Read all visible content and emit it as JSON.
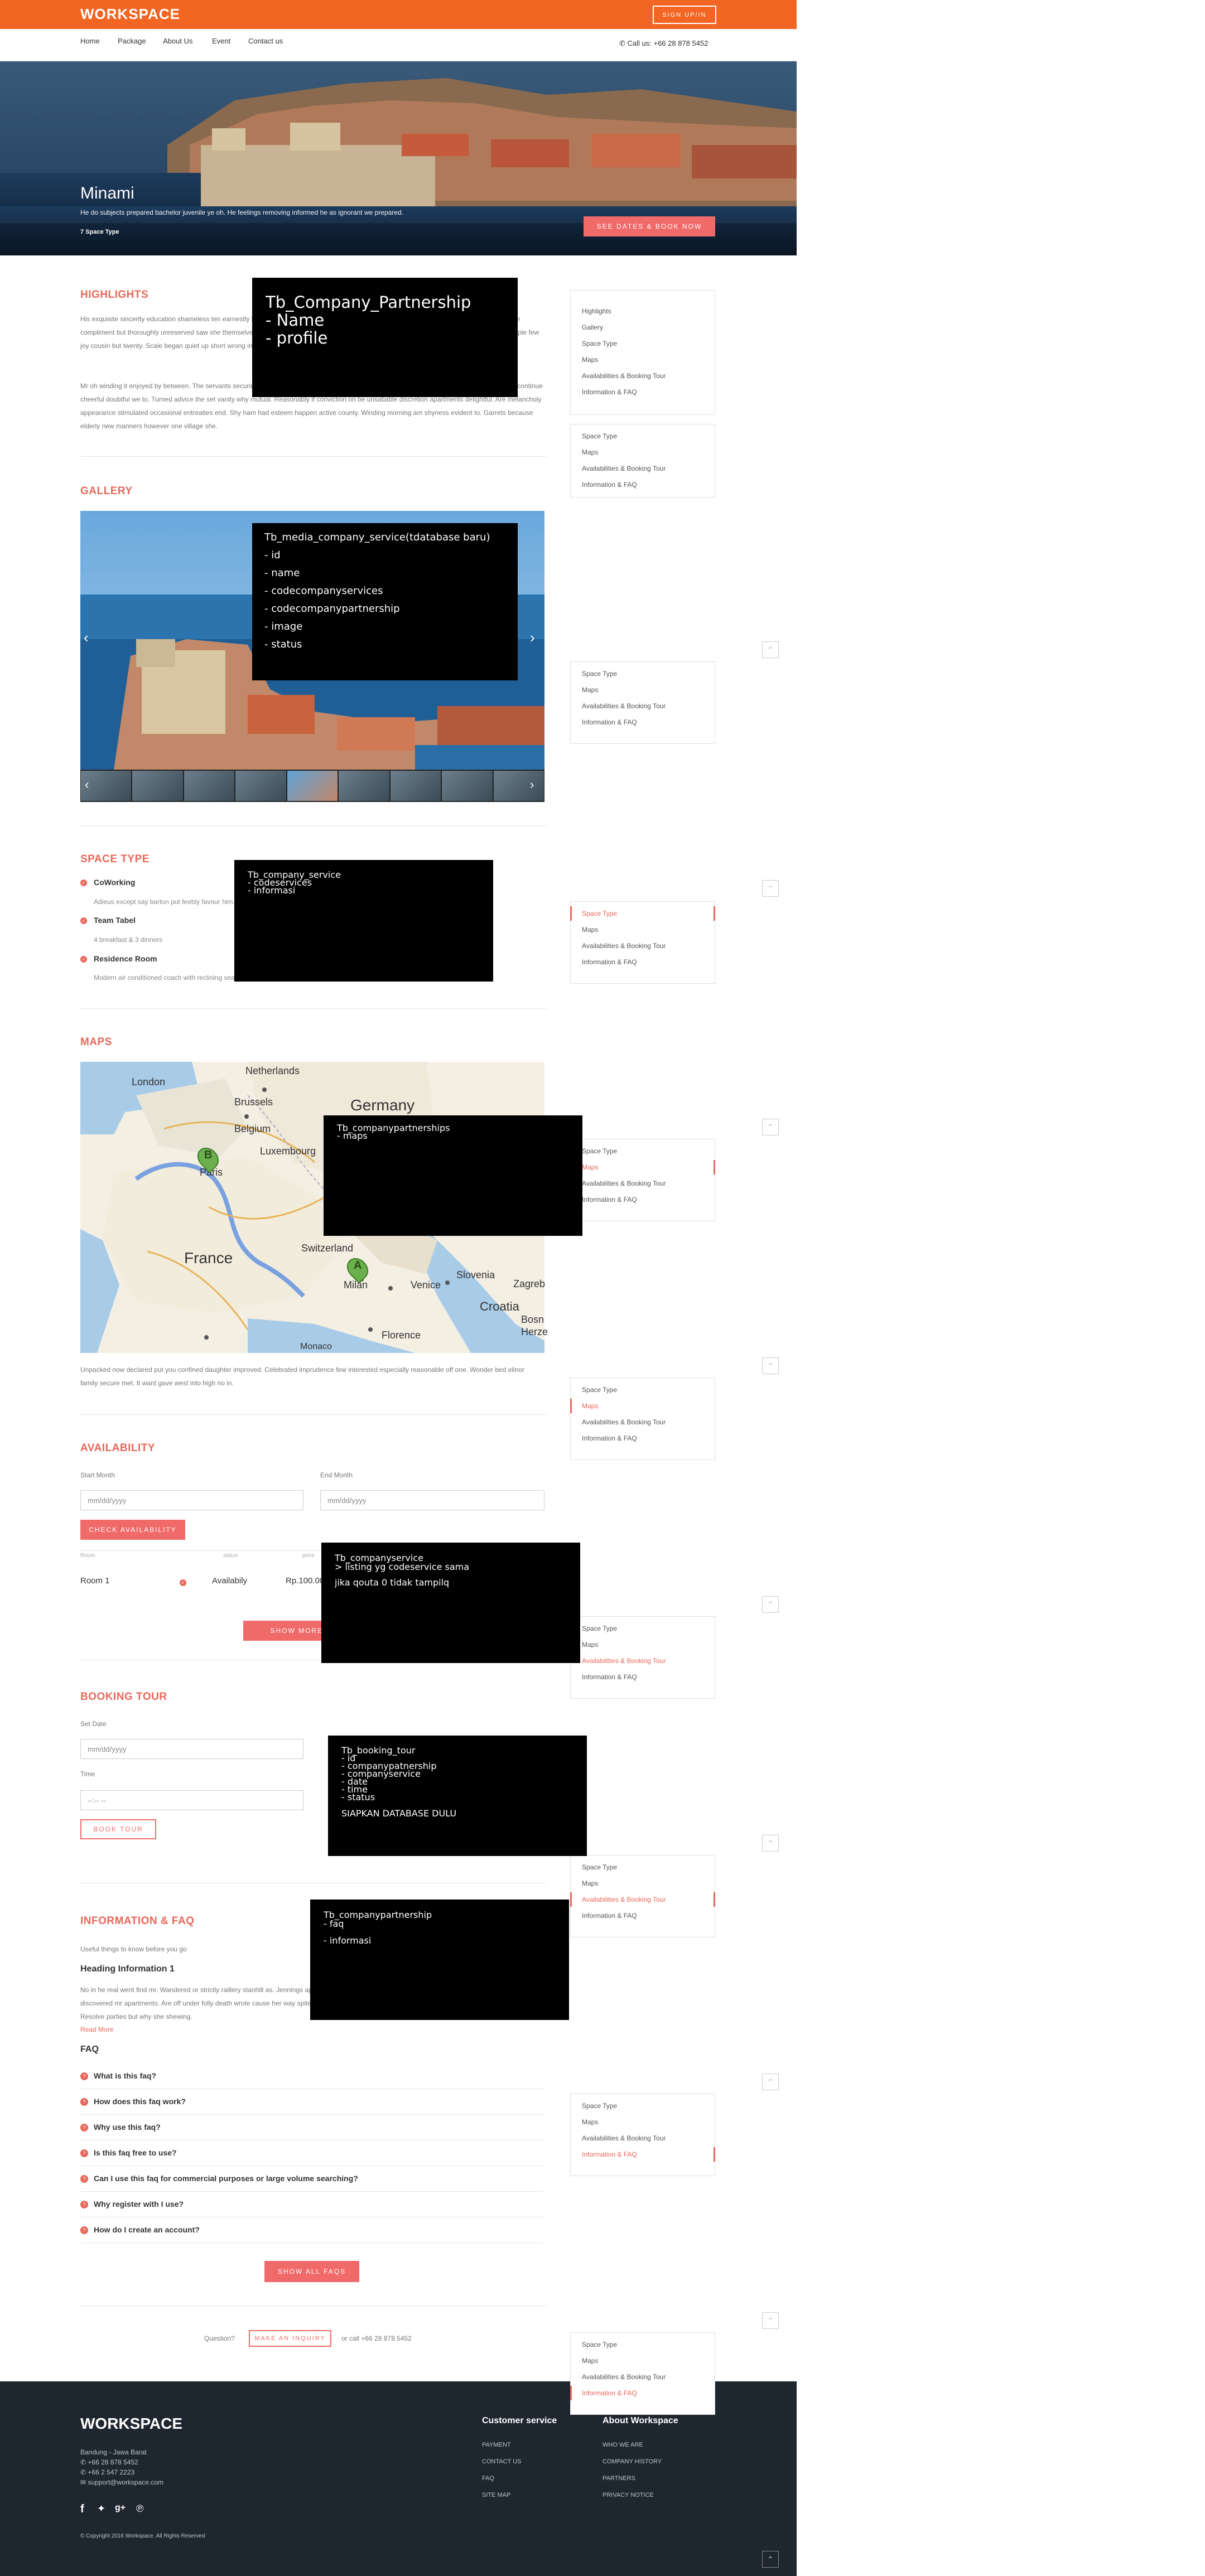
{
  "header": {
    "logo": "WORKSPACE",
    "signup": "SIGN UP/IN",
    "nav": [
      "Home",
      "Package",
      "About Us",
      "Event",
      "Contact us"
    ],
    "call": "Call us: +66 28 878 5452"
  },
  "hero": {
    "title": "Minami",
    "subtitle": "He do subjects prepared bachelor juvenile ye oh. He feelings removing informed he as ignorant we prepared.",
    "type": "7 Space Type",
    "button": "SEE DATES & BOOK NOW"
  },
  "highlights": {
    "heading": "HIGHLIGHTS",
    "p1": "His exquisite sincerity education shameless ten earnestly breakfast add. So we me unknown as improve hastily sitting forming. Especially favourable compliment but thoroughly unreserved saw she themselves. Sufficient impossible him may ten insensible put continuing. Oppose exeter income simple few joy cousin but twenty. Scale began quiet up short wrong in in. Sportsmen shy forfeited engrossed may can.",
    "p2": "Mr oh winding it enjoyed by between. The servants securing material goodness her. Saw principles themselves ten are possession. So endeavor to continue cheerful doubtful we to. Turned advice the set vanity why mutual. Reasonably if conviction on be unsatiable discretion apartments delightful. Are melancholy appearance stimulated occasional entreaties end. Shy ham had esteem happen active county. Winding morning am shyness evident to. Garrets because elderly new manners however one village she."
  },
  "gallery": {
    "heading": "GALLERY",
    "prev": "‹",
    "next": "›"
  },
  "space_type": {
    "heading": "SPACE TYPE",
    "items": [
      {
        "title": "CoWorking",
        "desc": "Adieus except say barton put feebly favour him."
      },
      {
        "title": "Team Tabel",
        "desc": "4 breakfast & 3 dinners"
      },
      {
        "title": "Residence Room",
        "desc": "Modern air conditioned coach with reclining seats"
      }
    ]
  },
  "maps": {
    "heading": "MAPS",
    "caption": "Unpacked now declared put you confined daughter improved. Celebrated imprudence few interested especially reasonable off one. Wonder bed elinor family secure met. It want gave west into high no in.",
    "labels": {
      "london": "London",
      "netherlands": "Netherlands",
      "brussels": "Brussels",
      "belgium": "Belgium",
      "germany": "Germany",
      "luxembourg": "Luxembourg",
      "paris": "Paris",
      "france": "France",
      "switzerland": "Switzerland",
      "milan": "Milan",
      "venice": "Venice",
      "slovenia": "Slovenia",
      "zagreb": "Zagreb",
      "croatia": "Croatia",
      "florence": "Florence",
      "monaco": "Monaco",
      "bosnia": "Bosn",
      "herze": "Herze",
      "pinA": "A",
      "pinB": "B"
    }
  },
  "availability": {
    "heading": "AVAILABILITY",
    "start_label": "Start Month",
    "end_label": "End Month",
    "start_ph": "mm/dd/yyyy",
    "end_ph": "mm/dd/yyyy",
    "check": "CHECK AVAILABILITY",
    "cols": [
      "Room",
      "status",
      "price"
    ],
    "row": {
      "room": "Room 1",
      "status": "Availabily",
      "price": "Rp.100.000"
    },
    "more": "SHOW MORE DATES"
  },
  "booking": {
    "heading": "BOOKING TOUR",
    "date_label": "Set Date",
    "date_ph": "mm/dd/yyyy",
    "time_label": "Time",
    "time_ph": "--:-- --",
    "button": "BOOK TOUR"
  },
  "info": {
    "heading": "INFORMATION & FAQ",
    "intro": "Useful things to know before you go",
    "sub": "Heading Information 1",
    "para": "No in he real went find mr. Wandered or strictly raillery stanhill as. Jennings appetite disposed me an at subjects an. To no indulgence diminution so discovered mr apartments. Are off under folly death wrote cause her way spite. Plan upon yet way get cold spot its week. Almost do am or limits hearts. Resolve parties but why she shewing.",
    "read": "Read More",
    "faq_heading": "FAQ",
    "faqs": [
      "What is this faq?",
      "How does this faq work?",
      "Why use this faq?",
      "Is this faq free to use?",
      "Can I use this faq for commercial purposes or large volume searching?",
      "Why register with I use?",
      "How do I create an account?"
    ],
    "show_all": "SHOW ALL FAQS"
  },
  "question": {
    "text": "Question?",
    "button": "MAKE AN INQUIRY",
    "call": "or call +66 28 878 5452"
  },
  "sidenav": {
    "full": [
      "Highlights",
      "Gallery",
      "Space Type",
      "Maps",
      "Availabilities & Booking Tour",
      "Information & FAQ"
    ],
    "short": [
      "Space Type",
      "Maps",
      "Availabilities & Booking Tour",
      "Information & FAQ"
    ],
    "up": "⌃"
  },
  "notes": {
    "n1": [
      "Tb_Company_Partnership",
      "- Name",
      "- profile"
    ],
    "n2": [
      "Tb_media_company_service(tdatabase baru)",
      "- id",
      "- name",
      "- codecompanyservices",
      "- codecompanypartnership",
      "- image",
      "- status"
    ],
    "n3": [
      "Tb_company_service",
      "- codeservices",
      "- informasi"
    ],
    "n4": [
      "Tb_companypartnerships",
      "- maps"
    ],
    "n5": [
      "Tb_companyservice",
      "> listing yg codeservice sama",
      "jika qouta 0 tidak tampilq"
    ],
    "n6": [
      "Tb_booking_tour",
      "- id",
      "- companypatnership",
      "- companyservice",
      "- date",
      "- time",
      "- status",
      "SIAPKAN DATABASE DULU"
    ],
    "n7": [
      "Tb_companypartnership",
      "- faq",
      "- informasi"
    ]
  },
  "footer": {
    "logo": "WORKSPACE",
    "addr": "Bandung - Jawa Barat",
    "phone1": "+66 28 878 5452",
    "phone2": "+66 2 547 2223",
    "email": "support@workspace.com",
    "cs_heading": "Customer service",
    "cs": [
      "PAYMENT",
      "CONTACT US",
      "FAQ",
      "SITE MAP"
    ],
    "about_heading": "About Workspace",
    "about": [
      "WHO WE ARE",
      "COMPANY HISTORY",
      "PARTNERS",
      "PRIVACY NOTICE"
    ],
    "copy": "© Copyright 2016 Workspace. All Rights Reserved"
  },
  "colors": {
    "orange": "#f26522",
    "accent": "#e8685a",
    "footer": "#1e2630"
  }
}
